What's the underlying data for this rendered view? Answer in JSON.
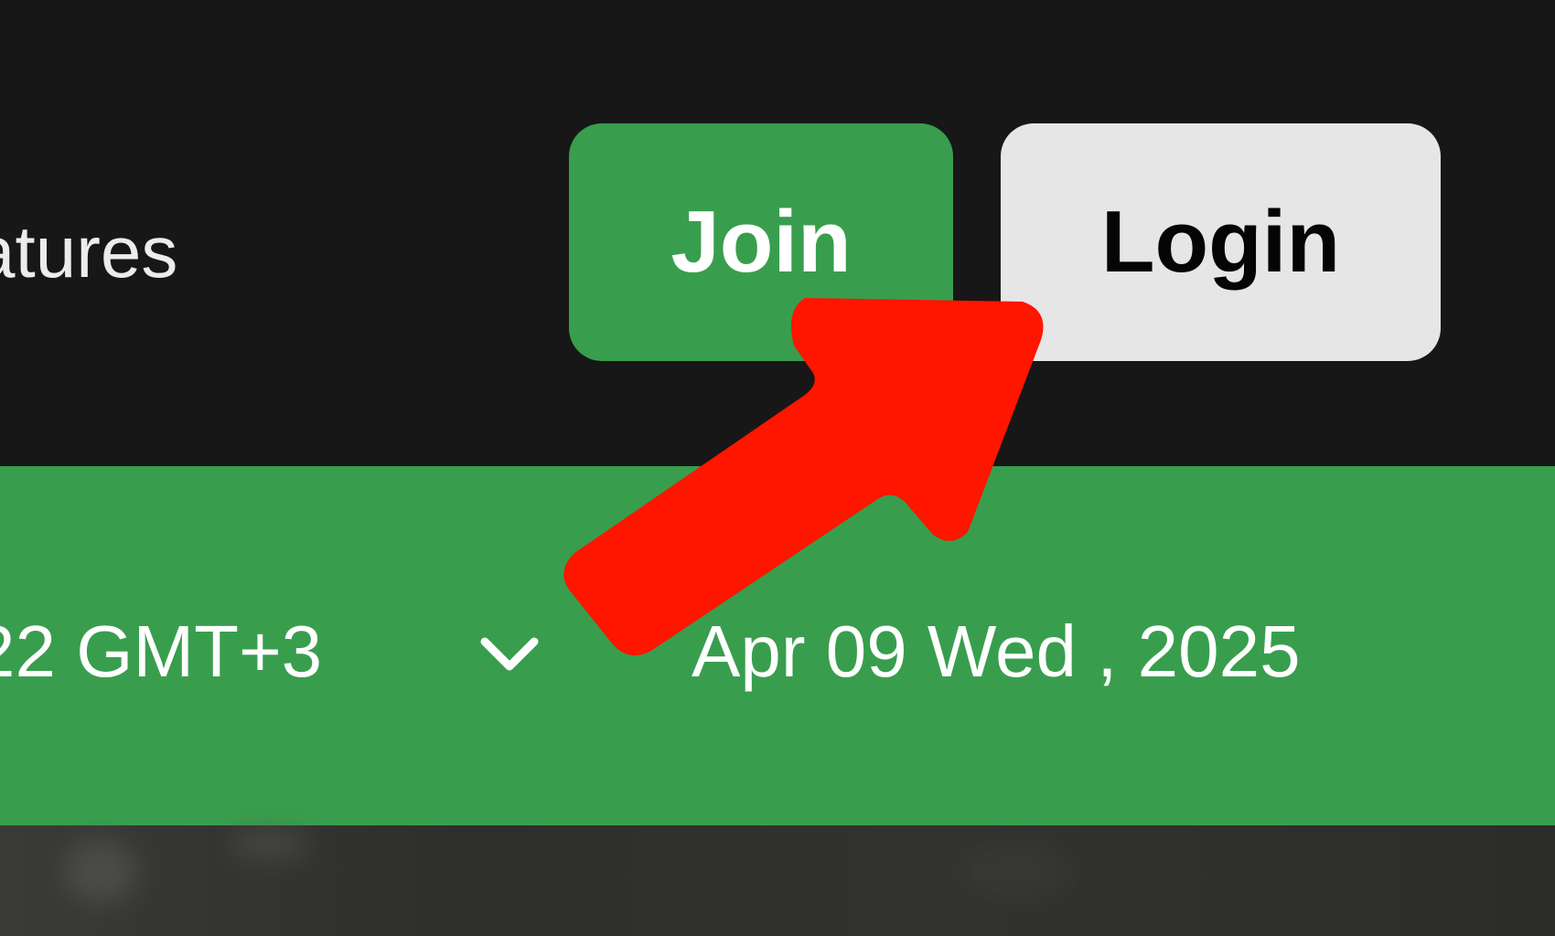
{
  "header": {
    "nav_partial_label": "atures",
    "join_label": "Join",
    "login_label": "Login"
  },
  "infobar": {
    "timezone_text": "22 GMT+3",
    "date_text": "Apr 09 Wed , 2025"
  },
  "colors": {
    "topbar_bg": "#171717",
    "brand_green": "#389e4d",
    "login_bg": "#e6e6e6",
    "arrow_red": "#ff1500"
  },
  "icons": {
    "timezone_dropdown": "chevron-down-icon",
    "annotation": "red-arrow-icon"
  }
}
